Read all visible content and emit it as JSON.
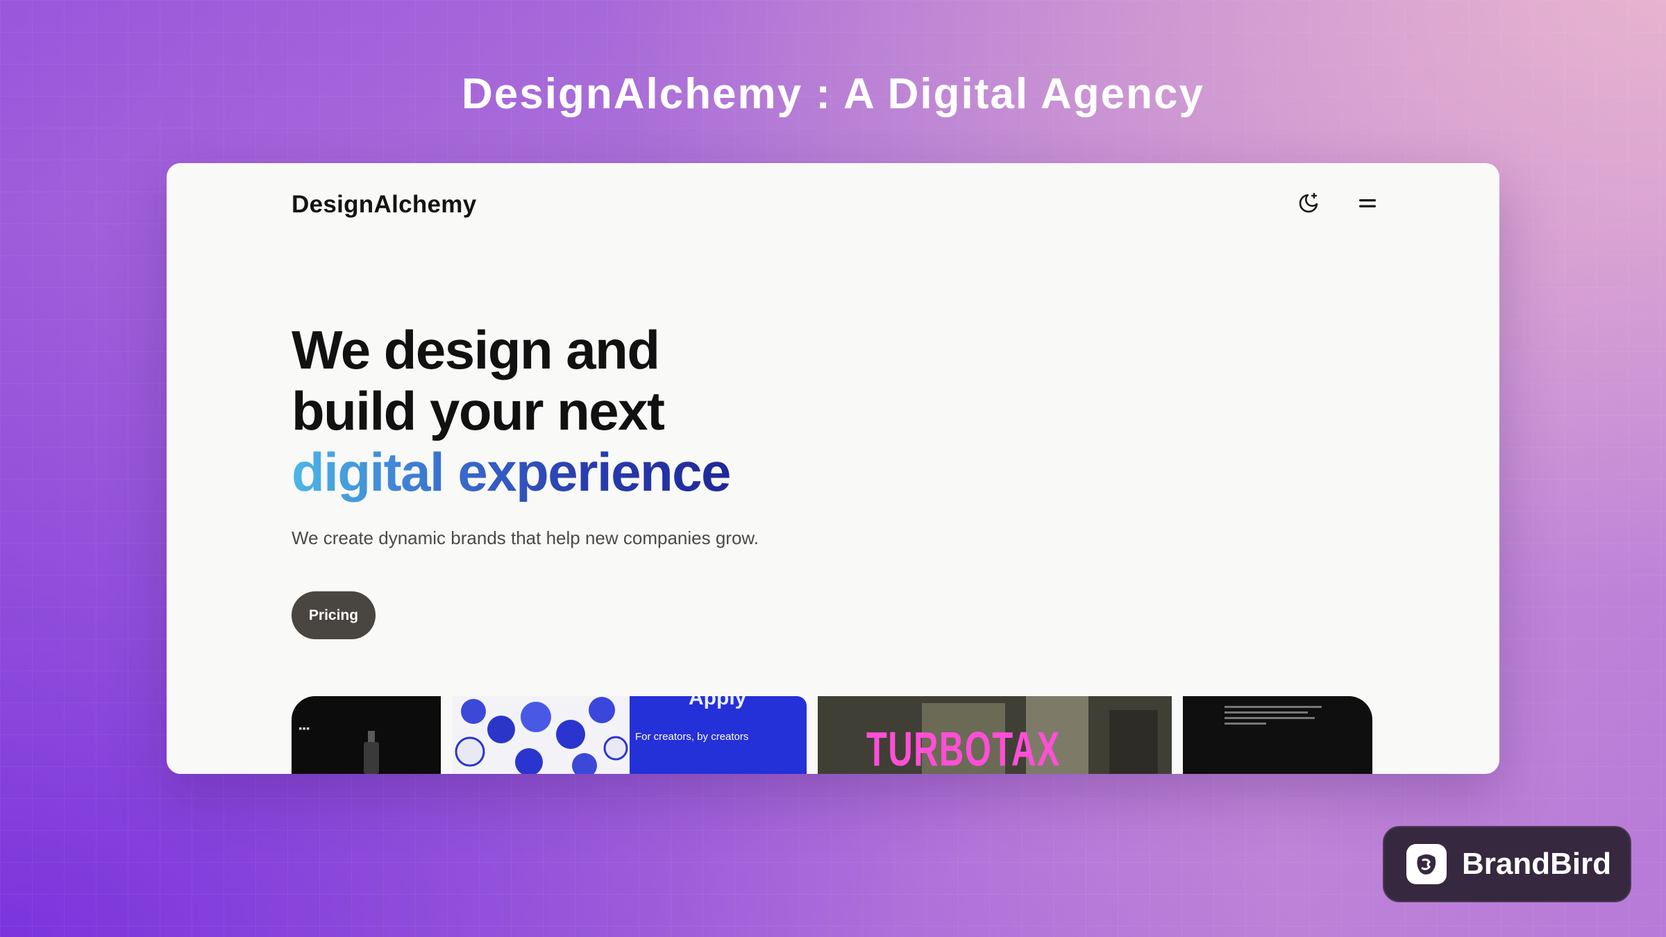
{
  "page": {
    "heading": "DesignAlchemy : A Digital Agency"
  },
  "site": {
    "logo": "DesignAlchemy",
    "header_icons": [
      "theme-toggle-icon",
      "menu-icon"
    ],
    "hero": {
      "line1": "We design and",
      "line2": "build your next",
      "line3": "digital experience",
      "subtitle": "We create dynamic brands that help new companies grow.",
      "cta_label": "Pricing"
    },
    "gallery": {
      "thumb2_title": "Apply",
      "thumb2_caption": "For creators, by creators",
      "thumb3_wordmark": "TURBOTAX"
    }
  },
  "badge": {
    "label": "BrandBird"
  },
  "colors": {
    "accent_gradient_start": "#4cb7e6",
    "accent_gradient_end": "#1f2799",
    "cta_background": "#494540",
    "card_background": "#f9f9f7"
  }
}
